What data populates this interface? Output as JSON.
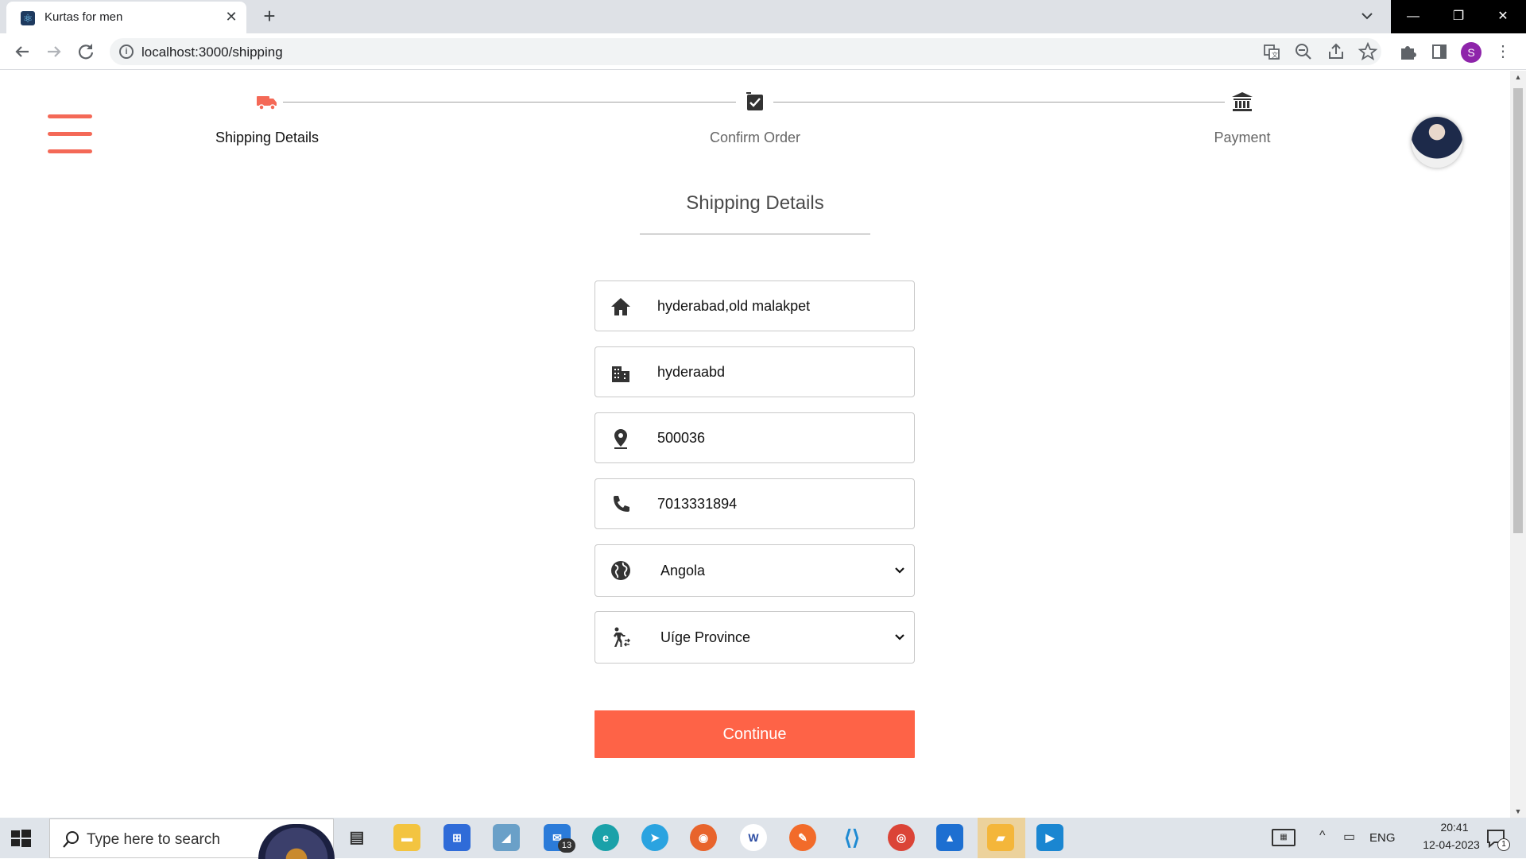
{
  "browser": {
    "tab_title": "Kurtas for men",
    "url": "localhost:3000/shipping",
    "profile_initial": "S"
  },
  "stepper": {
    "steps": [
      {
        "label": "Shipping Details",
        "active": true
      },
      {
        "label": "Confirm Order",
        "active": false
      },
      {
        "label": "Payment",
        "active": false
      }
    ]
  },
  "form": {
    "heading": "Shipping Details",
    "address": "hyderabad,old malakpet",
    "city": "hyderaabd",
    "pincode": "500036",
    "phone": "7013331894",
    "country": "Angola",
    "state": "Uíge Province",
    "continue_label": "Continue"
  },
  "taskbar": {
    "search_placeholder": "Type here to search",
    "mail_badge": "13",
    "language": "ENG",
    "time": "20:41",
    "date": "12-04-2023",
    "notification_count": "1"
  },
  "colors": {
    "accent": "#fe6347",
    "hamburger": "#f46957",
    "active_step_icon": "#f46957"
  }
}
